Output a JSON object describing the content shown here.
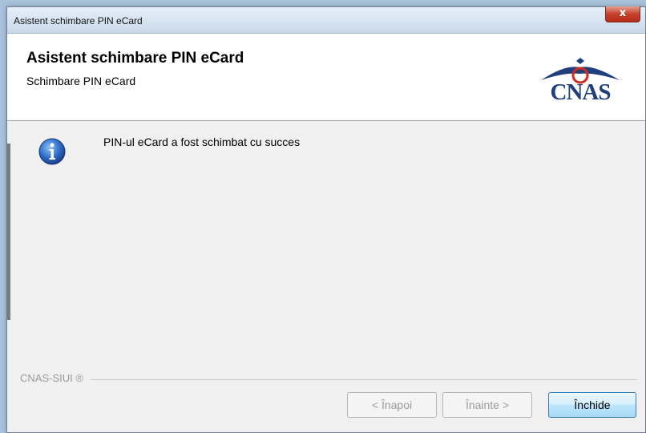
{
  "window": {
    "title": "Asistent schimbare PIN eCard",
    "close_glyph": "x"
  },
  "header": {
    "title": "Asistent schimbare PIN eCard",
    "subtitle": "Schimbare PIN eCard",
    "logo_text": "CNAS",
    "logo_color": "#1f3f7d",
    "logo_accent": "#d22a1e"
  },
  "content": {
    "icon": "info-icon",
    "message": "PIN-ul eCard a fost schimbat cu succes"
  },
  "footer": {
    "label": "CNAS-SIUI ®"
  },
  "buttons": {
    "back": "< Înapoi",
    "next": "Înainte >",
    "close": "Închide"
  }
}
